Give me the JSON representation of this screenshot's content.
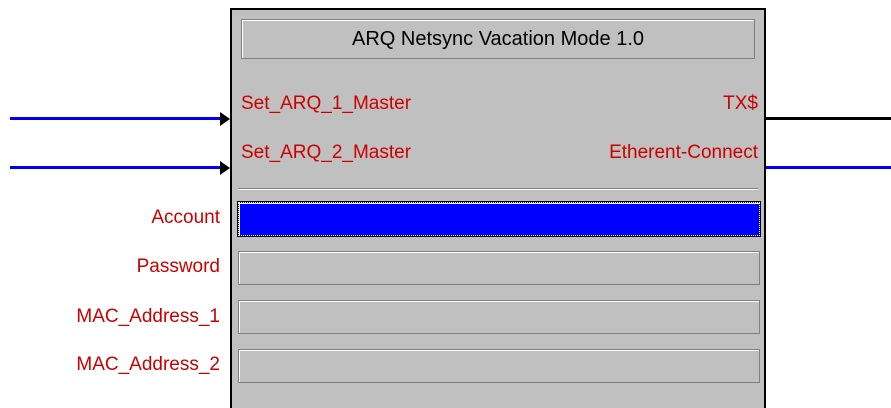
{
  "module": {
    "title": "ARQ Netsync Vacation Mode 1.0",
    "inputs": [
      "Set_ARQ_1_Master",
      "Set_ARQ_2_Master"
    ],
    "outputs": [
      "TX$",
      "Etherent-Connect"
    ],
    "parameters": [
      {
        "label": "Account",
        "value": ""
      },
      {
        "label": "Password",
        "value": ""
      },
      {
        "label": "MAC_Address_1",
        "value": ""
      },
      {
        "label": "MAC_Address_2",
        "value": ""
      }
    ]
  },
  "colors": {
    "input_wire": "#0000ee",
    "output_wire_tx": "#000000",
    "output_wire_eth": "#0000ee",
    "signal_text": "#cc0000",
    "active_field": "#0000ff",
    "module_body": "#c0c0c0"
  }
}
